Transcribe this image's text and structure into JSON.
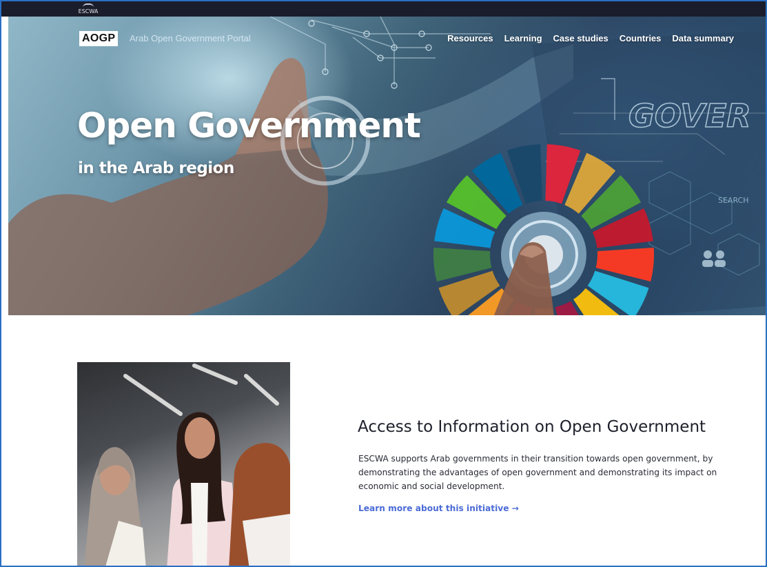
{
  "topbar": {
    "logo_text": "ESCWA"
  },
  "nav": {
    "brand": "AOGP",
    "brand_subtitle": "Arab Open Government Portal",
    "items": [
      {
        "label": "Resources"
      },
      {
        "label": "Learning"
      },
      {
        "label": "Case studies"
      },
      {
        "label": "Countries"
      },
      {
        "label": "Data summary"
      }
    ]
  },
  "hero": {
    "title": "Open Government",
    "subtitle": "in the Arab region",
    "image_text": "GOVER",
    "search_text": "SEARCH"
  },
  "intro": {
    "title": "Access to Information on Open Government",
    "body": "ESCWA supports Arab governments in their transition towards open government, by demonstrating the advantages of open government and demonstrating its impact on economic and social development.",
    "link": "Learn more about this initiative →"
  },
  "colors": {
    "frame_border": "#2b6fc4",
    "topbar": "#1a1d2b",
    "link": "#4b6bd6",
    "sdg_wheel": [
      "#e5243b",
      "#dda63a",
      "#4c9f38",
      "#c5192d",
      "#ff3a21",
      "#26bde2",
      "#fcc30b",
      "#a21942",
      "#fd6925",
      "#dd1367",
      "#fd9d24",
      "#bf8b2e",
      "#3f7e44",
      "#0a97d9",
      "#56c02b",
      "#00689d",
      "#19486a"
    ]
  }
}
